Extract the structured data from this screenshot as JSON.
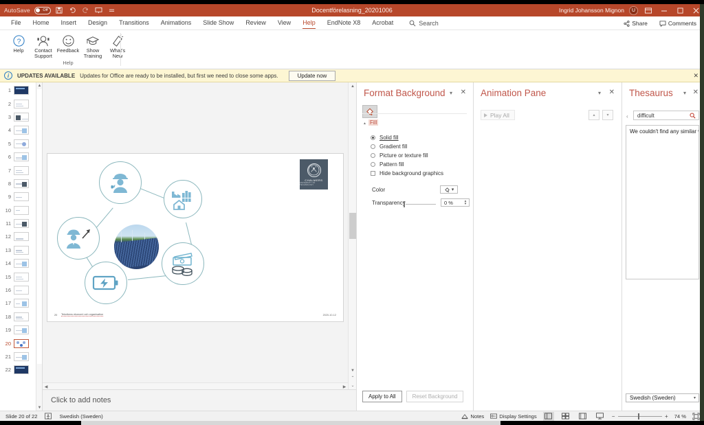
{
  "titlebar": {
    "autosave_label": "AutoSave",
    "autosave_state": "Off",
    "document_title": "Docentförelasning_20201006",
    "user_name": "Ingrid Johansson Mignon",
    "user_initial": "IJ",
    "qat": [
      {
        "name": "save-icon",
        "glyph": "὚b"
      },
      {
        "name": "undo-icon",
        "glyph": "↶"
      },
      {
        "name": "redo-icon",
        "glyph": "↻"
      },
      {
        "name": "start-presentation-icon",
        "glyph": "⊡"
      },
      {
        "name": "qat-more-icon",
        "glyph": "≡"
      }
    ],
    "window_buttons": [
      {
        "name": "ribbon-display-options-button",
        "glyph": "⬚"
      },
      {
        "name": "minimize-button",
        "glyph": "–"
      },
      {
        "name": "restore-button",
        "glyph": "❐"
      },
      {
        "name": "close-button",
        "glyph": "✕"
      }
    ]
  },
  "ribbon": {
    "tabs": [
      {
        "label": "File",
        "active": false
      },
      {
        "label": "Home",
        "active": false
      },
      {
        "label": "Insert",
        "active": false
      },
      {
        "label": "Design",
        "active": false
      },
      {
        "label": "Transitions",
        "active": false
      },
      {
        "label": "Animations",
        "active": false
      },
      {
        "label": "Slide Show",
        "active": false
      },
      {
        "label": "Review",
        "active": false
      },
      {
        "label": "View",
        "active": false
      },
      {
        "label": "Help",
        "active": true
      },
      {
        "label": "EndNote X8",
        "active": false
      },
      {
        "label": "Acrobat",
        "active": false
      }
    ],
    "search_label": "Search",
    "share_label": "Share",
    "comments_label": "Comments",
    "group_name": "Help",
    "buttons": [
      {
        "label": "Help",
        "icon": "question-mark-icon"
      },
      {
        "label": "Contact Support",
        "icon": "support-person-icon"
      },
      {
        "label": "Feedback",
        "icon": "smiley-face-icon"
      },
      {
        "label": "Show Training",
        "icon": "graduation-cap-icon"
      },
      {
        "label": "What's New",
        "icon": "megaphone-icon"
      }
    ]
  },
  "notification": {
    "badge": "UPDATES AVAILABLE",
    "message": "Updates for Office are ready to be installed, but first we need to close some apps.",
    "button_label": "Update now",
    "close_glyph": "✕"
  },
  "thumbnails": {
    "slides": [
      {
        "number": "1",
        "style": "dark"
      },
      {
        "number": "2",
        "style": "text"
      },
      {
        "number": "3",
        "style": "image"
      },
      {
        "number": "4",
        "style": "image"
      },
      {
        "number": "5",
        "style": "text"
      },
      {
        "number": "6",
        "style": "text"
      },
      {
        "number": "7",
        "style": "text"
      },
      {
        "number": "8",
        "style": "image"
      },
      {
        "number": "9",
        "style": "text"
      },
      {
        "number": "10",
        "style": "text"
      },
      {
        "number": "11",
        "style": "image"
      },
      {
        "number": "12",
        "style": "text"
      },
      {
        "number": "13",
        "style": "text"
      },
      {
        "number": "14",
        "style": "image"
      },
      {
        "number": "15",
        "style": "text"
      },
      {
        "number": "16",
        "style": "text"
      },
      {
        "number": "17",
        "style": "image"
      },
      {
        "number": "18",
        "style": "text"
      },
      {
        "number": "19",
        "style": "image"
      },
      {
        "number": "20",
        "style": "diagram",
        "selected": true
      },
      {
        "number": "21",
        "style": "image"
      },
      {
        "number": "22",
        "style": "dark"
      }
    ]
  },
  "slide": {
    "footer_number": "20",
    "footer_text": "Teknikens ekonomi och organisation",
    "footer_date": "2020-10-12",
    "logo": {
      "word": "CHALMERS",
      "sub": "UNIVERSITY OF TECHNOLOGY"
    },
    "nodes": [
      {
        "name": "node-worker-helmet",
        "icon": "engineer-icon"
      },
      {
        "name": "node-factory-city",
        "icon": "factory-house-icon"
      },
      {
        "name": "node-worker-tools",
        "icon": "worker-tools-icon"
      },
      {
        "name": "node-money",
        "icon": "money-coins-icon"
      },
      {
        "name": "node-battery",
        "icon": "battery-charge-icon"
      },
      {
        "name": "node-solar-photo",
        "icon": "solar-panel-photo"
      }
    ]
  },
  "notes": {
    "placeholder": "Click to add notes"
  },
  "format_background": {
    "title": "Format Background",
    "section_label": "Fill",
    "options": [
      {
        "label": "Solid fill",
        "selected": true
      },
      {
        "label": "Gradient fill",
        "selected": false
      },
      {
        "label": "Picture or texture fill",
        "selected": false
      },
      {
        "label": "Pattern fill",
        "selected": false
      }
    ],
    "checkbox_label": "Hide background graphics",
    "checkbox_checked": false,
    "color_label": "Color",
    "transparency_label": "Transparency",
    "transparency_value": "0 %",
    "apply_all_label": "Apply to All",
    "reset_label": "Reset Background",
    "caret_glyph": "▾",
    "close_glyph": "✕"
  },
  "animation_pane": {
    "title": "Animation Pane",
    "play_all_label": "Play All",
    "move_up_glyph": "▴",
    "move_down_glyph": "▾",
    "caret_glyph": "▾",
    "close_glyph": "✕"
  },
  "thesaurus": {
    "title": "Thesaurus",
    "back_glyph": "‹",
    "search_value": "difficult",
    "search_icon": "magnifier-icon",
    "result_text": "We couldn't find any similar words",
    "language": "Swedish (Sweden)",
    "caret_glyph": "▾",
    "close_glyph": "✕"
  },
  "statusbar": {
    "slide_counter": "Slide 20 of 22",
    "accessibility_icon": "accessibility-checker-icon",
    "language": "Swedish (Sweden)",
    "notes_label": "Notes",
    "display_settings_label": "Display Settings",
    "views": [
      {
        "name": "normal-view-button",
        "active": true
      },
      {
        "name": "slide-sorter-button",
        "active": false
      },
      {
        "name": "reading-view-button",
        "active": false
      },
      {
        "name": "slide-show-button",
        "active": false
      }
    ],
    "zoom_out_glyph": "−",
    "zoom_in_glyph": "+",
    "zoom_level": "74 %",
    "fit_slide_icon": "fit-to-window-icon"
  },
  "colors": {
    "accent": "#b7472a",
    "pane_title": "#c0564a",
    "notif_bg": "#fdf6d3",
    "node_stroke": "#8bb7bd",
    "icon_fill": "#7fb8d4"
  }
}
